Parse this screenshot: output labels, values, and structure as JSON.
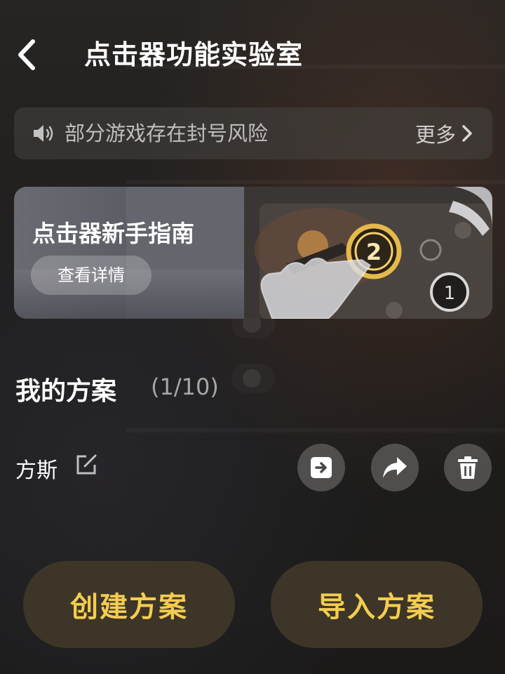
{
  "header": {
    "title": "点击器功能实验室",
    "back_icon": "chevron-left-icon"
  },
  "notice": {
    "icon": "speaker-icon",
    "text": "部分游戏存在封号风险",
    "more_label": "更多"
  },
  "banner": {
    "title": "点击器新手指南",
    "button_label": "查看详情",
    "step_badge_primary": "2",
    "step_badge_secondary": "1"
  },
  "plans": {
    "section_title": "我的方案",
    "count": "(1/10)",
    "items": [
      {
        "name": "方斯",
        "actions": [
          "import-icon",
          "share-icon",
          "trash-icon"
        ]
      }
    ]
  },
  "footer": {
    "create_label": "创建方案",
    "import_label": "导入方案"
  },
  "colors": {
    "accent_gold": "#f4cd4f",
    "button_bg": "#3d3528"
  }
}
